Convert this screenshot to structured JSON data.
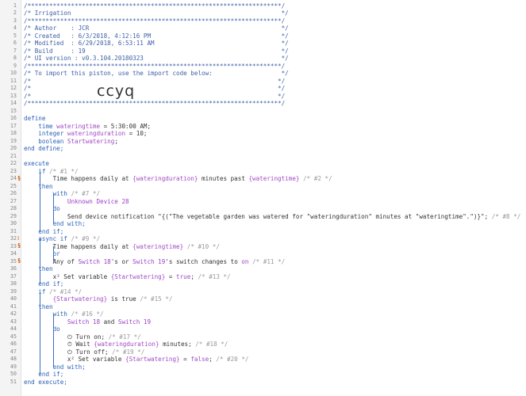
{
  "lines": [
    {
      "n": "1",
      "text": "/**********************************************************************/"
    },
    {
      "n": "2",
      "text": "/* Irrigation                                                          */"
    },
    {
      "n": "3",
      "text": "/**********************************************************************/"
    },
    {
      "n": "4",
      "text": "/* Author    : JCR                                                     */"
    },
    {
      "n": "5",
      "text": "/* Created   : 6/3/2018, 4:12:16 PM                                    */"
    },
    {
      "n": "6",
      "text": "/* Modified  : 6/29/2018, 6:53:11 AM                                   */"
    },
    {
      "n": "7",
      "text": "/* Build     : 19                                                      */"
    },
    {
      "n": "8",
      "text": "/* UI version : v0.3.104.20180323                                      */"
    },
    {
      "n": "9",
      "text": "/**********************************************************************/"
    },
    {
      "n": "10",
      "text": "/* To import this piston, use the import code below:                   */"
    },
    {
      "n": "11",
      "text": "/*                                                                    */"
    },
    {
      "n": "12",
      "text": "/*                                                                    */"
    },
    {
      "n": "13",
      "text": "/*                                                                    */"
    },
    {
      "n": "14",
      "text": "/**********************************************************************/"
    },
    {
      "n": "15",
      "text": ""
    },
    {
      "n": "16",
      "text": "define"
    },
    {
      "n": "17",
      "text": "    time wateringtime = 5:30:00 AM;"
    },
    {
      "n": "18",
      "text": "    integer wateringduration = 10;"
    },
    {
      "n": "19",
      "text": "    boolean Startwatering;"
    },
    {
      "n": "20",
      "text": "end define;"
    },
    {
      "n": "21",
      "text": ""
    },
    {
      "n": "22",
      "text": "execute"
    },
    {
      "n": "23",
      "text": "    if /* #1 */"
    },
    {
      "n": "24",
      "text": "        Time happens daily at {wateringduration} minutes past {wateringtime} /* #2 */"
    },
    {
      "n": "25",
      "text": "    then"
    },
    {
      "n": "26",
      "text": "        with /* #7 */"
    },
    {
      "n": "27",
      "text": "            Unknown Device 28"
    },
    {
      "n": "28",
      "text": "        do"
    },
    {
      "n": "29",
      "text": "            Send device notification \"{(\"The vegetable garden was watered for \"wateringduration\" minutes at \"wateringtime\".\")}\"; /* #8 */"
    },
    {
      "n": "30",
      "text": "        end with;"
    },
    {
      "n": "31",
      "text": "    end if;"
    },
    {
      "n": "32",
      "text": "    async if /* #9 */"
    },
    {
      "n": "33",
      "text": "        Time happens daily at {wateringtime} /* #10 */"
    },
    {
      "n": "34",
      "text": "        or"
    },
    {
      "n": "35",
      "text": "        Any of Switch 18's or Switch 19's switch changes to on /* #11 */"
    },
    {
      "n": "36",
      "text": "    then"
    },
    {
      "n": "37",
      "text": "        x² Set variable {Startwatering} = true; /* #13 */"
    },
    {
      "n": "38",
      "text": "    end if;"
    },
    {
      "n": "39",
      "text": "    if /* #14 */"
    },
    {
      "n": "40",
      "text": "        {Startwatering} is true /* #15 */"
    },
    {
      "n": "41",
      "text": "    then"
    },
    {
      "n": "42",
      "text": "        with /* #16 */"
    },
    {
      "n": "43",
      "text": "            Switch 18 and Switch 19"
    },
    {
      "n": "44",
      "text": "        do"
    },
    {
      "n": "45",
      "text": "            ⏻ Turn on; /* #17 */"
    },
    {
      "n": "46",
      "text": "            ⏱ Wait {wateringduration} minutes; /* #18 */"
    },
    {
      "n": "47",
      "text": "            ⏻ Turn off; /* #19 */"
    },
    {
      "n": "48",
      "text": "            x² Set variable {Startwatering} = false; /* #20 */"
    },
    {
      "n": "49",
      "text": "        end with;"
    },
    {
      "n": "50",
      "text": "    end if;"
    },
    {
      "n": "51",
      "text": "end execute;"
    }
  ],
  "import_code": "ccyq"
}
